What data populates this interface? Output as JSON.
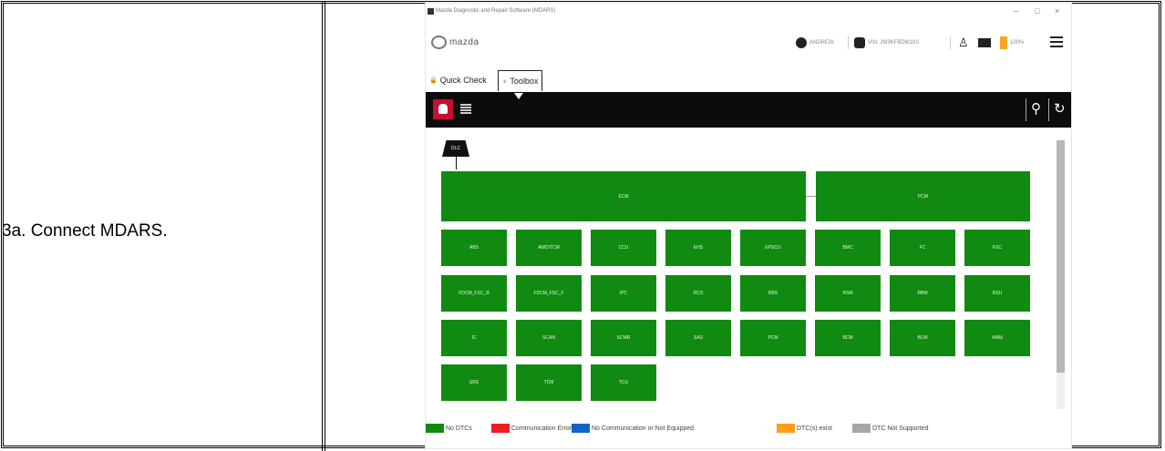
{
  "step": {
    "label": "3a. Connect MDARS."
  },
  "window": {
    "title": "Mazda Diagnostic and Repair Software (MDARS)",
    "minimize": "–",
    "maximize": "□",
    "close": "×"
  },
  "header": {
    "brand": "mazda",
    "user_text": "ANDREW",
    "vin_text": "VIN: JM3KFBDM1K0",
    "battery_text": "100%"
  },
  "tabs": [
    {
      "label": "Quick Check",
      "icon": "lock-icon"
    },
    {
      "label": "Toolbox",
      "icon": "person-icon"
    }
  ],
  "toolbar": {
    "left_icons": [
      "network-icon",
      "table-icon"
    ],
    "right_icons": [
      "wrench-icon",
      "refresh-icon"
    ]
  },
  "diagram": {
    "dlc": "DLC",
    "top_modules": [
      "ECM",
      "PCM"
    ],
    "rows": [
      [
        "ABS",
        "AWD/TCM",
        "CCU",
        "EHS",
        "EPSCU",
        "BMC",
        "FC",
        "FSC"
      ],
      [
        "FDCM_FSC_R",
        "FDCM_FSC_F",
        "IPC",
        "RCS",
        "RBS",
        "RSM",
        "RBM",
        "RSU"
      ],
      [
        "IC",
        "SCAN",
        "SCMR",
        "SAS",
        "PCM",
        "BCM",
        "BCM",
        "AMM"
      ],
      [
        "SRS",
        "TCM",
        "TCU"
      ]
    ]
  },
  "legend": [
    {
      "label": "No DTCs",
      "color": "#118a11"
    },
    {
      "label": "Communication Error",
      "color": "#ee1c24"
    },
    {
      "label": "No Communication or Not Equipped",
      "color": "#1064c8"
    },
    {
      "label": "DTC(s) exist",
      "color": "#ff9c1a"
    },
    {
      "label": "DTC Not Supported",
      "color": "#a7a7a7"
    }
  ]
}
